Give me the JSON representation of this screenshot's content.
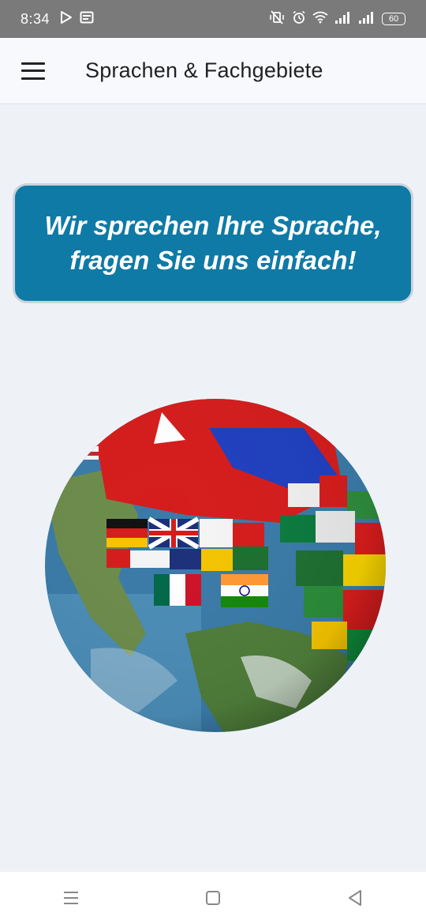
{
  "status_bar": {
    "time": "8:34",
    "battery": "60"
  },
  "app_bar": {
    "title": "Sprachen & Fachgebiete"
  },
  "banner": {
    "line1": "Wir sprechen Ihre Sprache,",
    "line2": "fragen Sie uns einfach!"
  },
  "colors": {
    "banner_bg": "#0f7aa6",
    "page_bg": "#eef2f7",
    "status_bar_bg": "#7a7a7a"
  },
  "icons": {
    "menu": "hamburger-menu-icon",
    "play_store": "play-store-icon",
    "notification": "notification-icon",
    "mute_vibrate": "vibrate-mute-icon",
    "alarm": "alarm-icon",
    "wifi": "wifi-icon",
    "signal": "signal-icon",
    "nav_recents": "recents-icon",
    "nav_home": "home-icon",
    "nav_back": "back-icon"
  }
}
